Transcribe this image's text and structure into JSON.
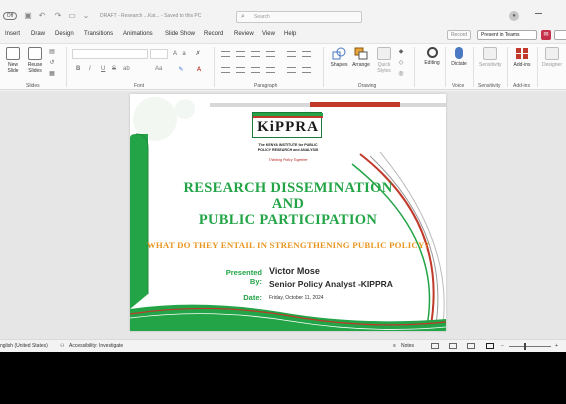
{
  "titlebar": {
    "autosave_label": "Off",
    "document_title": "DRAFT - Research ...Kat... - Saved to this PC",
    "search_placeholder": "Search"
  },
  "menu": {
    "tabs": [
      "Insert",
      "Draw",
      "Design",
      "Transitions",
      "Animations",
      "Slide Show",
      "Record",
      "Review",
      "View",
      "Help"
    ],
    "record_label": "Record",
    "teams_label": "Present in Teams"
  },
  "ribbon": {
    "slides": {
      "new_slide": "New Slide",
      "reuse_slides": "Reuse Slides",
      "group": "Slides"
    },
    "font": {
      "group": "Font",
      "format_buttons": [
        "B",
        "I",
        "U",
        "S",
        "ab",
        "Aa"
      ]
    },
    "paragraph": {
      "group": "Paragraph"
    },
    "drawing": {
      "shapes": "Shapes",
      "arrange": "Arrange",
      "quick_styles": "Quick Styles",
      "group": "Drawing"
    },
    "editing": {
      "label": "Editing"
    },
    "voice": {
      "dictate": "Dictate",
      "group": "Voice"
    },
    "sensitivity": {
      "label": "Sensitivity",
      "group": "Sensitivity"
    },
    "addins": {
      "label": "Add-ins",
      "group": "Add-ins"
    },
    "designer": {
      "label": "Designer"
    }
  },
  "slide": {
    "logo_text": "KiPPRA",
    "logo_subtitle_line1": "The KENYA INSTITUTE for PUBLIC",
    "logo_subtitle_line2": "POLICY RESEARCH and ANALYSIS",
    "logo_tagline": "Thinking Policy Together",
    "title_line1": "RESEARCH DISSEMINATION",
    "title_line2": "AND",
    "title_line3": "PUBLIC PARTICIPATION",
    "subtitle": "WHAT DO THEY ENTAIL IN STRENGTHENING PUBLIC POLICY?",
    "presented_label_line1": "Presented",
    "presented_label_line2": "By:",
    "presenter_name": "Victor Mose",
    "presenter_role": "Senior Policy Analyst -KIPPRA",
    "date_label": "Date:",
    "date_value": "Friday, October 11, 2024",
    "colors": {
      "green": "#23a447",
      "orange": "#e8961f",
      "red": "#c0392b"
    }
  },
  "statusbar": {
    "language": "nglish (United States)",
    "accessibility": "Accessibility: Investigate",
    "notes": "Notes"
  }
}
